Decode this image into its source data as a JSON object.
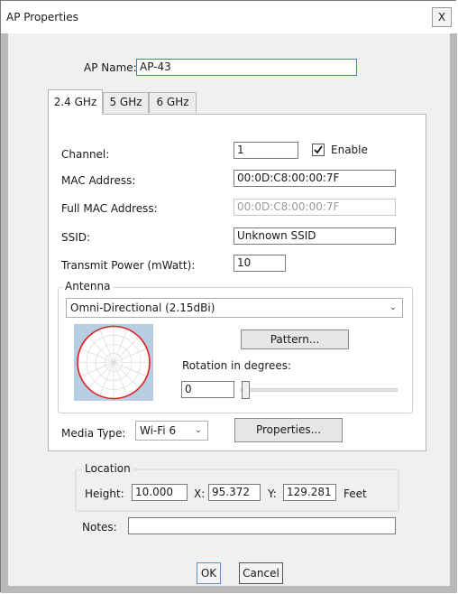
{
  "window": {
    "title": "AP Properties",
    "close_label": "X"
  },
  "ap_name": {
    "label": "AP Name:",
    "value": "AP-43"
  },
  "tabs": [
    {
      "label": "2.4 GHz",
      "active": true
    },
    {
      "label": "5 GHz",
      "active": false
    },
    {
      "label": "6 GHz",
      "active": false
    }
  ],
  "fields": {
    "channel": {
      "label": "Channel:",
      "value": "1"
    },
    "enable": {
      "label": "Enable",
      "checked": true
    },
    "mac": {
      "label": "MAC Address:",
      "value": "00:0D:C8:00:00:7F"
    },
    "full_mac": {
      "label": "Full MAC Address:",
      "value": "00:0D:C8:00:00:7F"
    },
    "ssid": {
      "label": "SSID:",
      "value": "Unknown SSID"
    },
    "tx_power": {
      "label": "Transmit Power (mWatt):",
      "value": "10"
    }
  },
  "antenna": {
    "group_label": "Antenna",
    "selected": "Omni-Directional (2.15dBi)",
    "pattern_button": "Pattern...",
    "rotation_label": "Rotation in degrees:",
    "rotation_value": "0",
    "pattern_icon": "polar-pattern-icon"
  },
  "media": {
    "label": "Media Type:",
    "selected": "Wi-Fi 6",
    "properties_button": "Properties..."
  },
  "location": {
    "group_label": "Location",
    "height_label": "Height:",
    "height_value": "10.000",
    "x_label": "X:",
    "x_value": "95.372",
    "y_label": "Y:",
    "y_value": "129.281",
    "unit": "Feet"
  },
  "notes": {
    "label": "Notes:",
    "value": ""
  },
  "buttons": {
    "ok": "OK",
    "cancel": "Cancel"
  },
  "colors": {
    "focus_border": "#3b7fd1",
    "pattern_background": "#b7cde2",
    "pattern_circle": "#e0201f"
  }
}
